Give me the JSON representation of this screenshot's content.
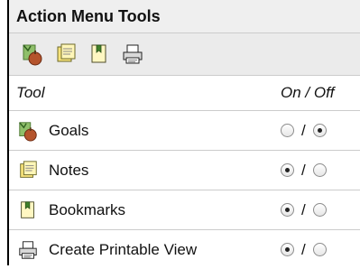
{
  "panel": {
    "title": "Action Menu Tools",
    "toolbar_icons": [
      "goals-icon",
      "notes-icon",
      "bookmarks-icon",
      "printer-icon"
    ],
    "header": {
      "tool": "Tool",
      "on_off": "On / Off"
    },
    "separator": "/",
    "rows": [
      {
        "label": "Goals",
        "icon": "goals-icon",
        "on": false
      },
      {
        "label": "Notes",
        "icon": "notes-icon",
        "on": true
      },
      {
        "label": "Bookmarks",
        "icon": "bookmarks-icon",
        "on": true
      },
      {
        "label": "Create Printable View",
        "icon": "printer-icon",
        "on": true
      }
    ]
  }
}
